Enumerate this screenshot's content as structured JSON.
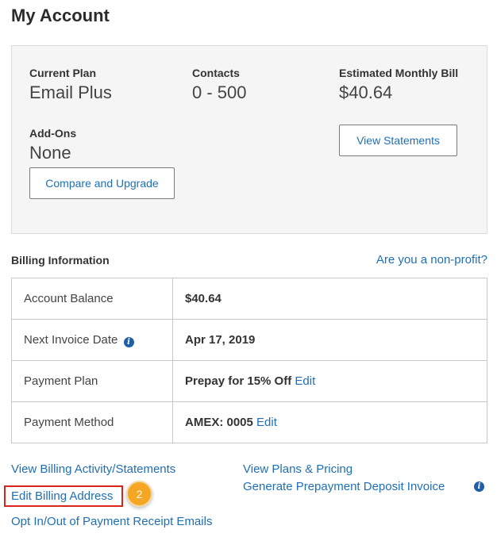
{
  "page": {
    "title": "My Account"
  },
  "plan": {
    "current_plan_label": "Current Plan",
    "current_plan_value": "Email Plus",
    "contacts_label": "Contacts",
    "contacts_value": "0 - 500",
    "bill_label": "Estimated Monthly Bill",
    "bill_value": "$40.64",
    "addons_label": "Add-Ons",
    "addons_value": "None",
    "view_statements_label": "View Statements",
    "compare_upgrade_label": "Compare and Upgrade"
  },
  "billing": {
    "heading": "Billing Information",
    "nonprofit_link": "Are you a non-profit?",
    "rows": [
      {
        "label": "Account Balance",
        "value": "$40.64",
        "edit": ""
      },
      {
        "label": "Next Invoice Date",
        "value": "Apr 17, 2019",
        "edit": "",
        "info_icon": "info-icon"
      },
      {
        "label": "Payment Plan",
        "value": "Prepay for 15% Off",
        "edit": "Edit"
      },
      {
        "label": "Payment Method",
        "value": "AMEX: 0005",
        "edit": "Edit"
      }
    ]
  },
  "links": {
    "view_billing_activity": "View Billing Activity/Statements",
    "edit_billing_address": "Edit Billing Address",
    "opt_in_out": "Opt In/Out of Payment Receipt Emails",
    "view_plans_pricing": "View Plans & Pricing",
    "generate_prepayment": "Generate Prepayment Deposit Invoice"
  },
  "annotation": {
    "step_number": "2",
    "highlight_color": "#d9261c",
    "badge_color": "#f5a623"
  },
  "colors": {
    "link": "#1f6fb5",
    "card_bg": "#f5f5f5",
    "info_icon": "#1f5fa8"
  }
}
